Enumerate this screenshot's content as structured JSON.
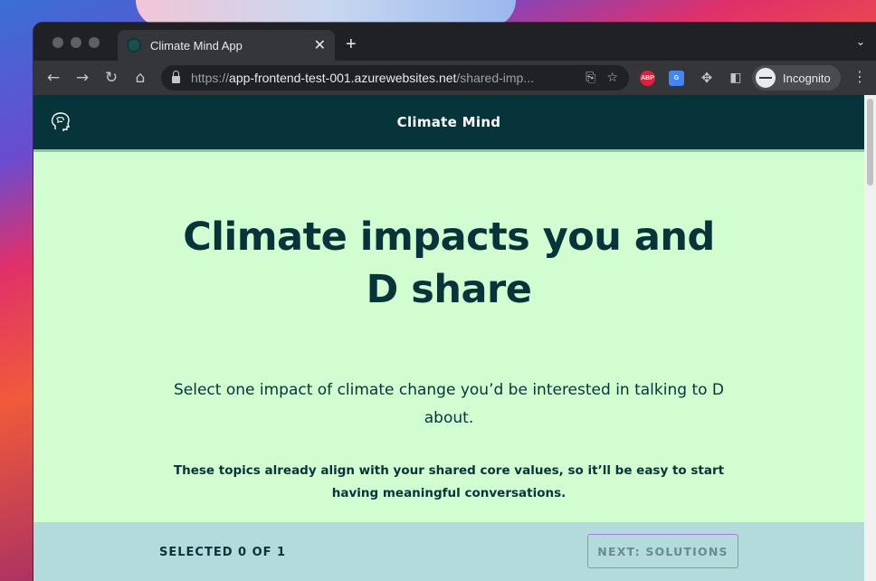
{
  "browser": {
    "tab": {
      "title": "Climate Mind App",
      "close_glyph": "✕"
    },
    "new_tab_glyph": "+",
    "url": {
      "host": "https://app-frontend-test-001.azurewebsites.net",
      "path": "/shared-imp..."
    },
    "profile_label": "Incognito",
    "extensions": [
      {
        "name": "abp-icon",
        "label": "ABP",
        "color": "#e0203a"
      },
      {
        "name": "google-translate-icon",
        "label": "G",
        "color": "#4285f4"
      }
    ]
  },
  "app": {
    "title": "Climate Mind",
    "headline_line1": "Climate impacts you and",
    "headline_line2": "D share",
    "subtitle": "Select one impact of climate change you’d be interested in talking to D about.",
    "note": "These topics already align with your shared core values, so it’ll be easy to start having meaningful conversations.",
    "footer": {
      "selected_text": "SELECTED 0 OF 1",
      "next_button": "NEXT: SOLUTIONS"
    }
  },
  "colors": {
    "header_bg": "#06343a",
    "page_bg": "#d2fdd0",
    "footer_bg": "#b4dbdb",
    "button_border": "#a87be8"
  }
}
